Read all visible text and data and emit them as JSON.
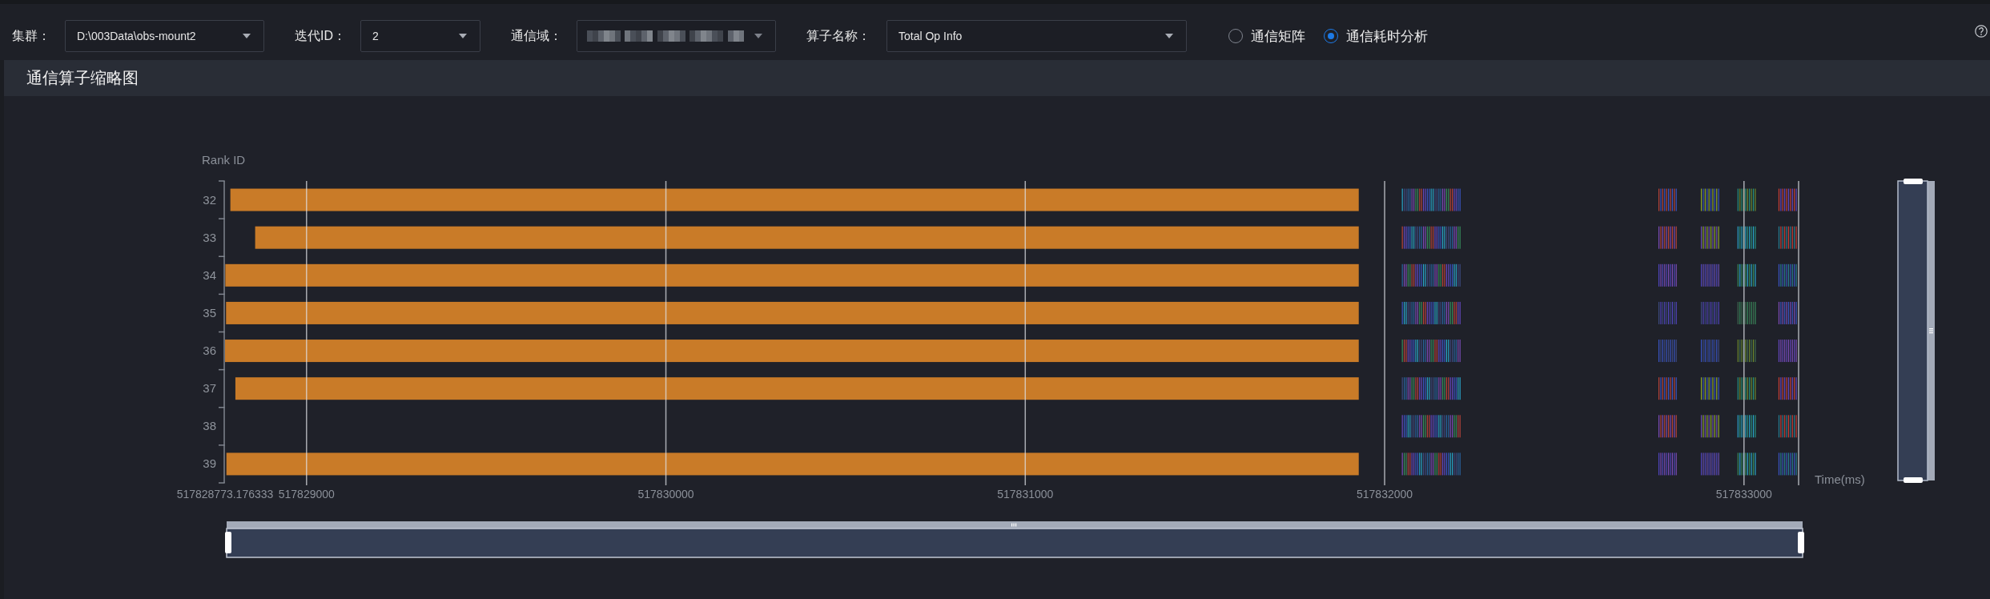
{
  "toolbar": {
    "filters": [
      {
        "kind": "select",
        "label": "集群：",
        "value": "D:\\003Data\\obs-mount2"
      },
      {
        "kind": "select",
        "label": "迭代ID：",
        "value": "2"
      },
      {
        "kind": "blurred",
        "label": "通信域："
      },
      {
        "kind": "select",
        "label": "算子名称：",
        "value": "Total Op Info"
      }
    ],
    "view_options": [
      {
        "label": "通信矩阵",
        "selected": false
      },
      {
        "label": "通信耗时分析",
        "selected": true
      }
    ]
  },
  "panel": {
    "title": "通信算子缩略图",
    "chart": {
      "y_title": "Rank ID",
      "ranks": [
        "32",
        "33",
        "34",
        "35",
        "36",
        "37",
        "38",
        "39"
      ],
      "time_labels": [
        "517828773.176333",
        "517829000",
        "517830000",
        "517831000",
        "517832000",
        "517833000"
      ],
      "x_title": "Time(ms)"
    },
    "x_zoom": {
      "level": 1
    },
    "y_zoom": {
      "level": 1
    }
  }
}
